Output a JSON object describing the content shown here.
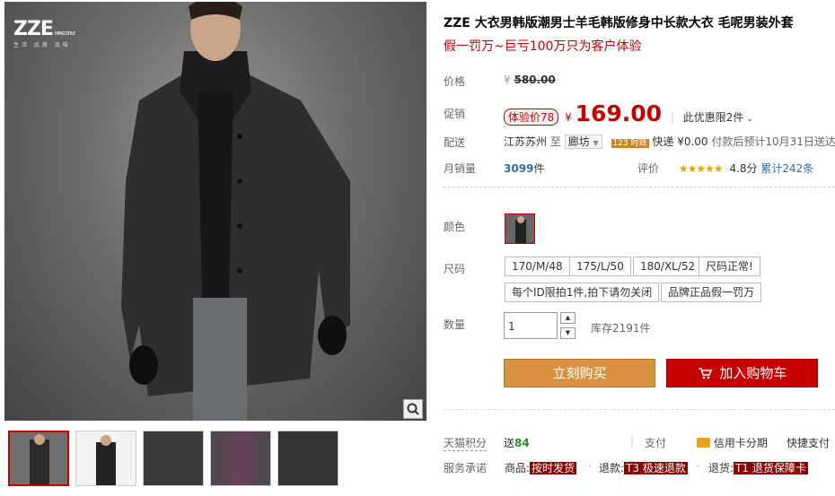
{
  "brand": {
    "logo": "ZZE",
    "logo_small": "MANG STYLE",
    "tagline": "生活 品质 品味"
  },
  "title": "ZZE 大衣男韩版潮男士羊毛韩版修身中长款大衣 毛呢男装外套",
  "subtitle": "假一罚万~巨亏100万只为客户体验",
  "price": {
    "label": "价格",
    "currency": "¥",
    "original": "580.00"
  },
  "promo": {
    "label": "促销",
    "badge": "体验价78",
    "currency": "¥",
    "price": "169.00",
    "limit": "此优惠限2件"
  },
  "delivery": {
    "label": "配送",
    "from": "江苏苏州",
    "to_word": "至",
    "to": "廊坊",
    "time_badge": "123 时效",
    "express": "快递 ¥0.00",
    "note": "付款后预计10月31日送达"
  },
  "sales": {
    "label": "月销量",
    "count": "3099",
    "unit": "件",
    "rating_label": "评价",
    "stars": "★★★★★",
    "score": "4.8分",
    "reviews": "累计242条"
  },
  "color": {
    "label": "颜色"
  },
  "size": {
    "label": "尺码",
    "options": [
      "170/M/48",
      "175/L/50",
      "180/XL/52",
      "尺码正常!"
    ],
    "notes": [
      "每个ID限拍1件,拍下请勿关闭",
      "品牌正品假一罚万"
    ]
  },
  "quantity": {
    "label": "数量",
    "value": "1",
    "stock": "库存2191件"
  },
  "buttons": {
    "buy": "立刻购买",
    "cart": "加入购物车"
  },
  "bottom": {
    "points_label": "天猫积分",
    "points_prefix": "送",
    "points": "84",
    "pay_label": "支付",
    "credit": "信用卡分期",
    "quick": "快捷支付",
    "service_label": "服务承诺",
    "goods_prefix": "商品:",
    "goods_tag": "按时发货",
    "refund_prefix": "退款:",
    "refund_tag": "T3 极速退款",
    "return_prefix": "退货:",
    "return_tag": "T1 退货保障卡"
  },
  "icons": {
    "zoom": "magnifier-icon",
    "cart": "cart-icon",
    "card": "credit-card-icon"
  }
}
